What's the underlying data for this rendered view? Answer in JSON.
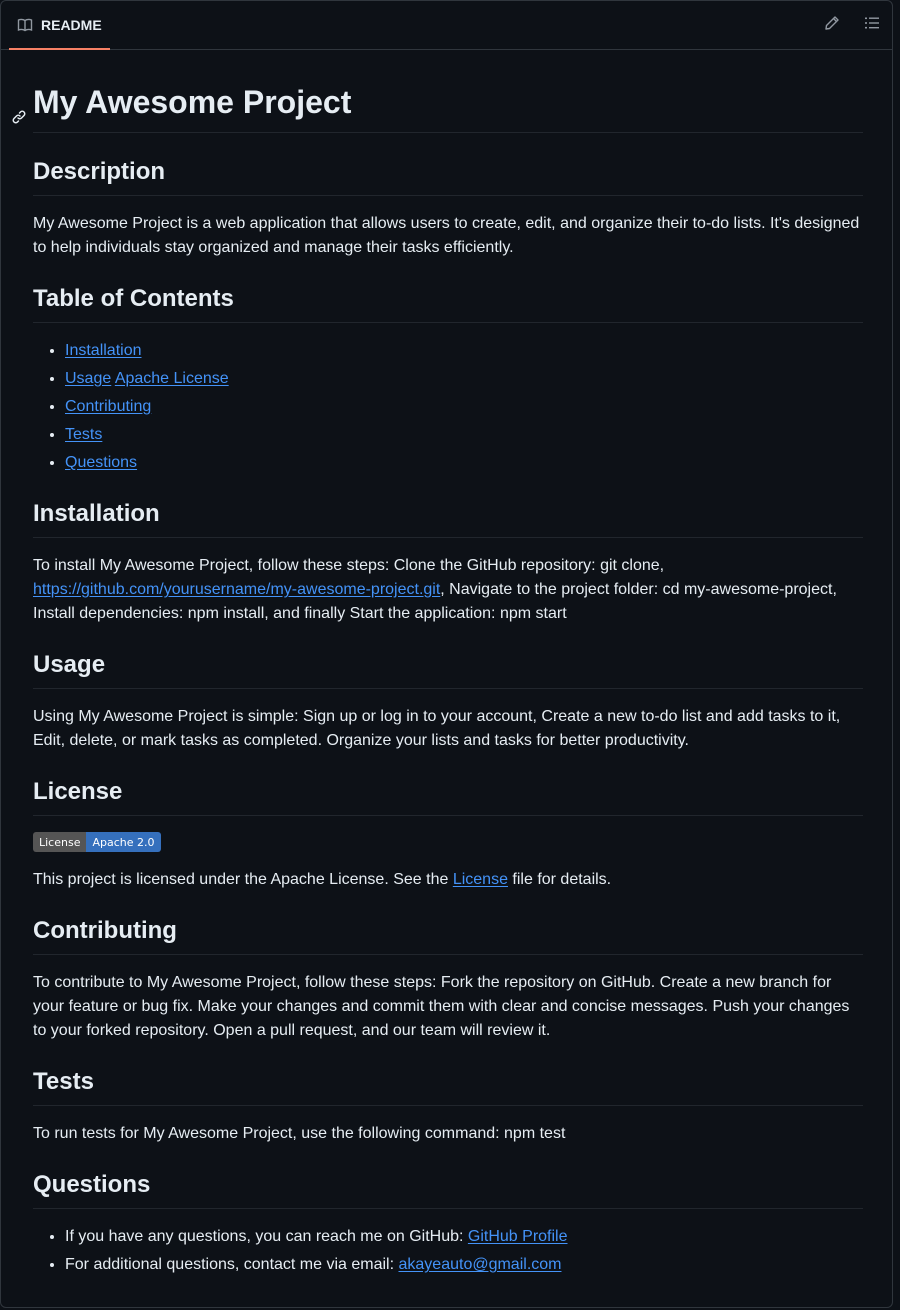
{
  "header": {
    "tab_label": "README",
    "tab_icon": "book-icon",
    "edit_icon": "pencil-icon",
    "outline_icon": "list-unordered-icon"
  },
  "colors": {
    "background": "#0d1117",
    "border": "#30363d",
    "text": "#e6edf3",
    "link": "#4493f8",
    "tab_accent": "#f78166",
    "badge_left": "#555555",
    "badge_right": "#3570bd"
  },
  "readme": {
    "title": "My Awesome Project",
    "description": {
      "heading": "Description",
      "text": "My Awesome Project is a web application that allows users to create, edit, and organize their to-do lists. It's designed to help individuals stay organized and manage their tasks efficiently."
    },
    "toc": {
      "heading": "Table of Contents",
      "items": [
        "Installation",
        "Usage",
        "Apache License",
        "Contributing",
        "Tests",
        "Questions"
      ]
    },
    "installation": {
      "heading": "Installation",
      "text_before": "To install My Awesome Project, follow these steps: Clone the GitHub repository: git clone, ",
      "link": "https://github.com/yourusername/my-awesome-project.git",
      "text_after": ", Navigate to the project folder: cd my-awesome-project, Install dependencies: npm install, and finally Start the application: npm start"
    },
    "usage": {
      "heading": "Usage",
      "text": "Using My Awesome Project is simple: Sign up or log in to your account, Create a new to-do list and add tasks to it, Edit, delete, or mark tasks as completed. Organize your lists and tasks for better productivity."
    },
    "license": {
      "heading": "License",
      "badge_left": "License",
      "badge_right": "Apache 2.0",
      "text_before": "This project is licensed under the Apache License. See the ",
      "link": "License",
      "text_after": " file for details."
    },
    "contributing": {
      "heading": "Contributing",
      "text": "To contribute to My Awesome Project, follow these steps: Fork the repository on GitHub. Create a new branch for your feature or bug fix. Make your changes and commit them with clear and concise messages. Push your changes to your forked repository. Open a pull request, and our team will review it."
    },
    "tests": {
      "heading": "Tests",
      "text": "To run tests for My Awesome Project, use the following command: npm test"
    },
    "questions": {
      "heading": "Questions",
      "item1_text": "If you have any questions, you can reach me on GitHub: ",
      "item1_link": "GitHub Profile",
      "item2_text": "For additional questions, contact me via email: ",
      "item2_link": "akayeauto@gmail.com"
    }
  }
}
